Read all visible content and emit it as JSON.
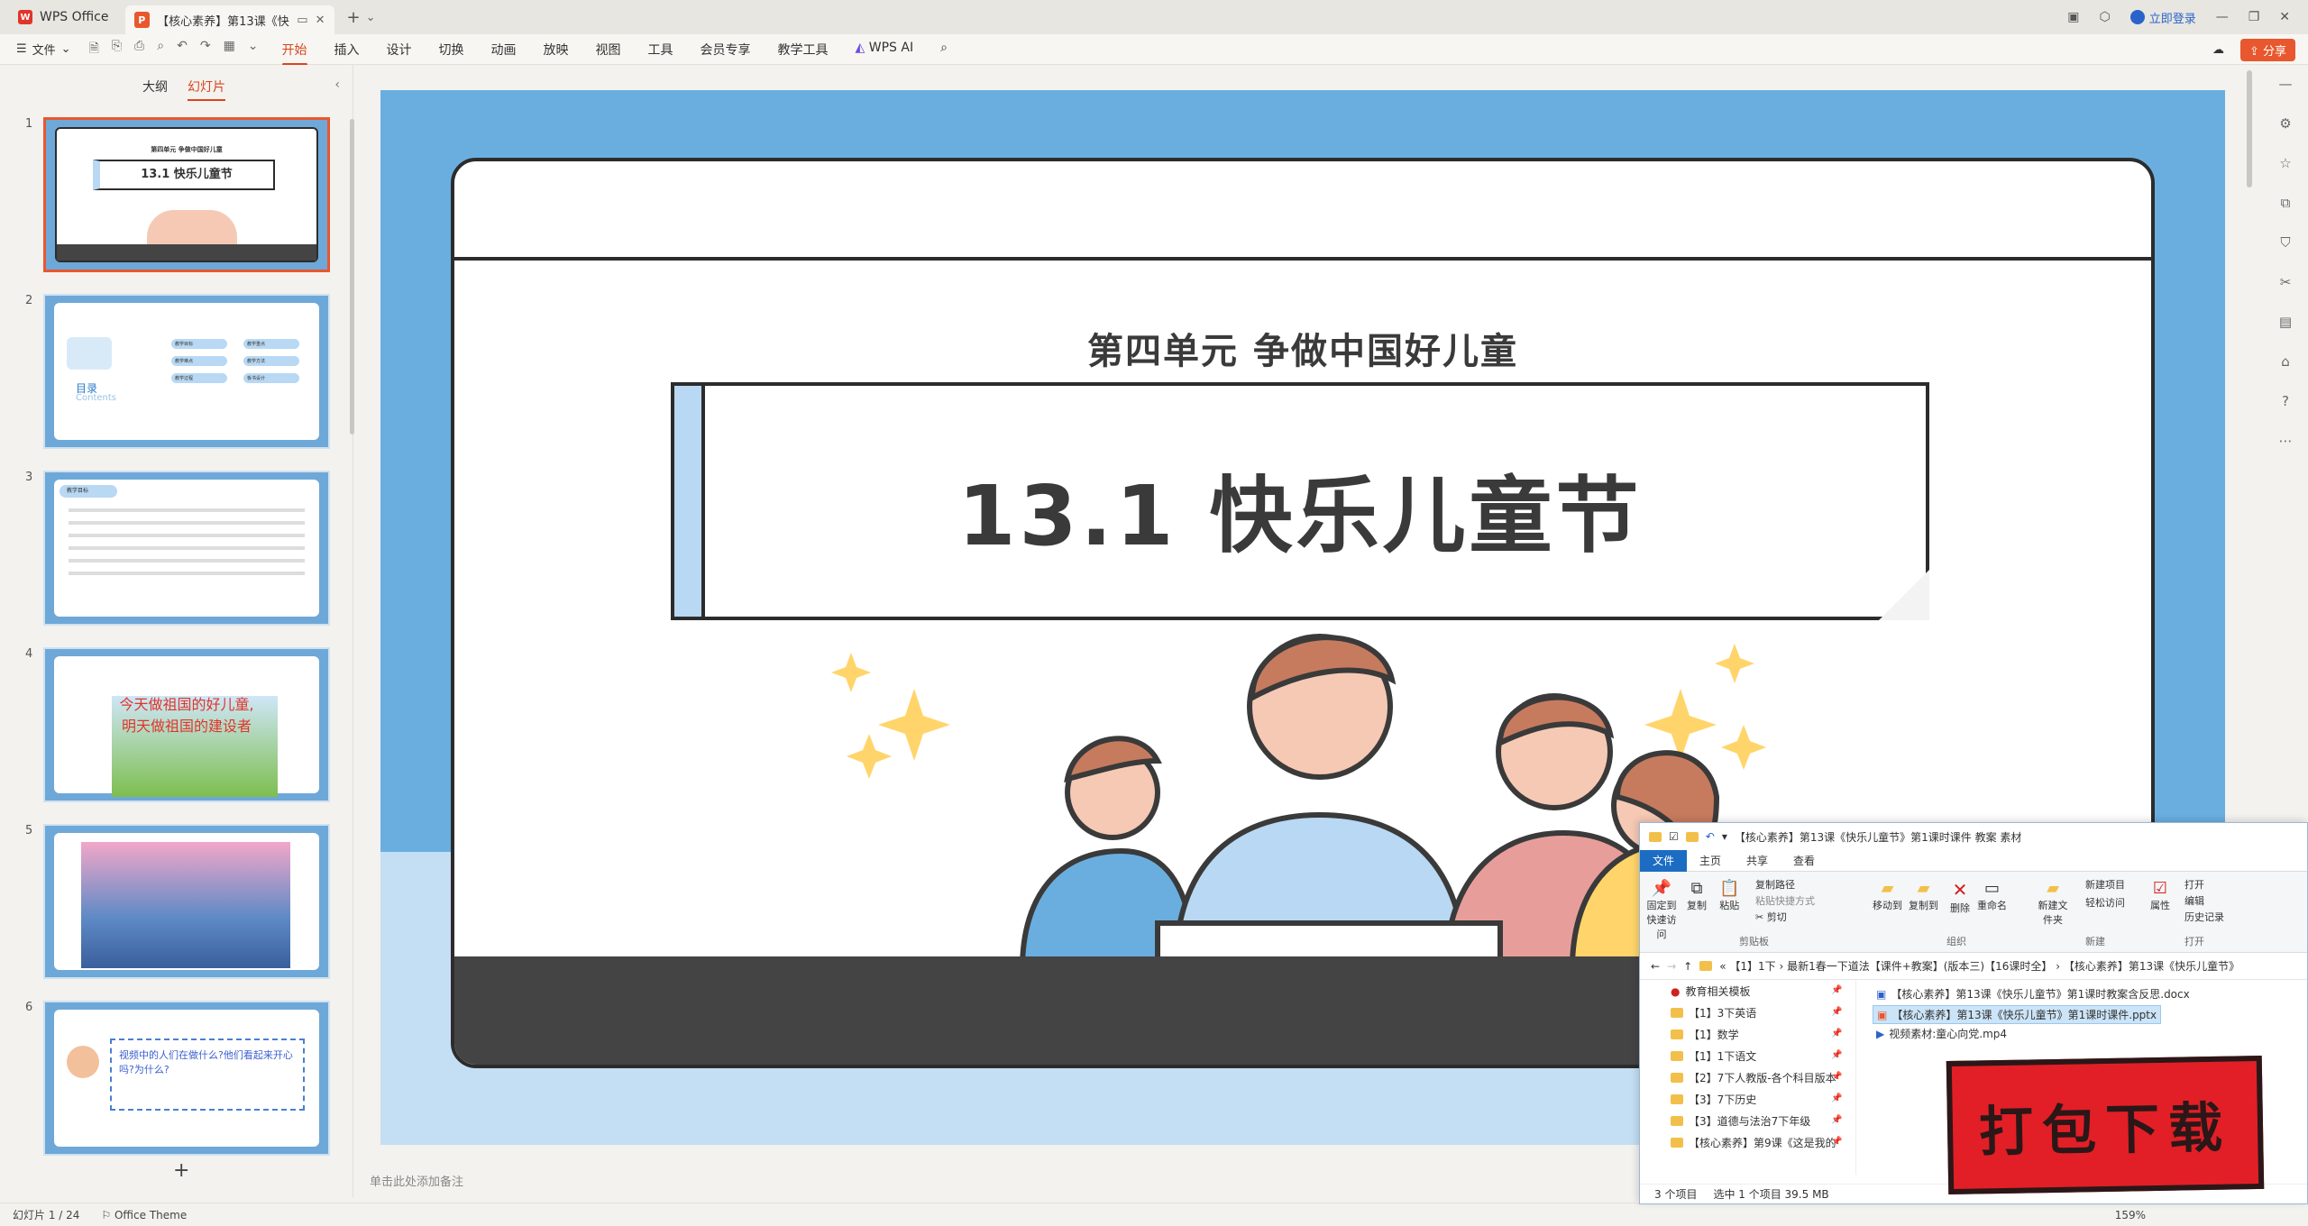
{
  "titlebar": {
    "app_name": "WPS Office",
    "doc_tab_title": "【核心素养】第13课《快乐儿",
    "login_label": "立即登录"
  },
  "ribbon": {
    "file_label": "文件",
    "menu": [
      "开始",
      "插入",
      "设计",
      "切换",
      "动画",
      "放映",
      "视图",
      "工具",
      "会员专享",
      "教学工具"
    ],
    "active_menu": "开始",
    "wps_ai_label": "WPS AI",
    "share_label": "分享"
  },
  "left_panel": {
    "tabs": [
      "大纲",
      "幻灯片"
    ],
    "active_tab": "幻灯片",
    "thumbnails": [
      {
        "num": "1",
        "heading": "第四单元 争做中国好儿童",
        "title": "13.1 快乐儿童节"
      },
      {
        "num": "2",
        "heading": "目录",
        "subheading": "Contents",
        "items": [
          "教学目标",
          "教学重点",
          "教学难点",
          "教学方法",
          "教学过程",
          "板书设计"
        ]
      },
      {
        "num": "3",
        "heading": "教学目标"
      },
      {
        "num": "4",
        "line1": "今天做祖国的好儿童,",
        "line2": "明天做祖国的建设者"
      },
      {
        "num": "5"
      },
      {
        "num": "6",
        "question": "视频中的人们在做什么?他们看起来开心吗?为什么?"
      }
    ]
  },
  "slide": {
    "subtitle": "第四单元 争做中国好儿童",
    "title": "13.1  快乐儿童节",
    "notes_placeholder": "单击此处添加备注"
  },
  "statusbar": {
    "slide_count": "幻灯片 1 / 24",
    "theme": "Office Theme",
    "zoom": "159%"
  },
  "explorer": {
    "title": "【核心素养】第13课《快乐儿童节》第1课时课件 教案 素材",
    "tabs": [
      "文件",
      "主页",
      "共享",
      "查看"
    ],
    "ribbon_items": [
      "固定到快速访问",
      "复制",
      "粘贴",
      "复制路径",
      "粘贴快捷方式",
      "剪切",
      "移动到",
      "复制到",
      "删除",
      "重命名",
      "新建文件夹",
      "新建项目",
      "轻松访问",
      "属性",
      "打开",
      "编辑",
      "历史记录"
    ],
    "ribbon_groups": [
      "剪贴板",
      "组织",
      "新建",
      "打开"
    ],
    "address": [
      "【1】1下",
      "最新1春一下道法【课件+教案】(版本三)【16课时全】",
      "【核心素养】第13课《快乐儿童节》"
    ],
    "nav_items": [
      "教育相关模板",
      "【1】3下英语",
      "【1】数学",
      "【1】1下语文",
      "【2】7下人教版-各个科目版本",
      "【3】7下历史",
      "【3】道德与法治7下年级",
      "【核心素养】第9课《这是我的"
    ],
    "files": [
      "【核心素养】第13课《快乐儿童节》第1课时教案含反思.docx",
      "【核心素养】第13课《快乐儿童节》第1课时课件.pptx",
      "视频素材:童心向党.mp4"
    ],
    "status_items": "3 个项目",
    "status_selected": "选中 1 个项目  39.5 MB"
  },
  "stamp": {
    "text": "打包下载"
  }
}
